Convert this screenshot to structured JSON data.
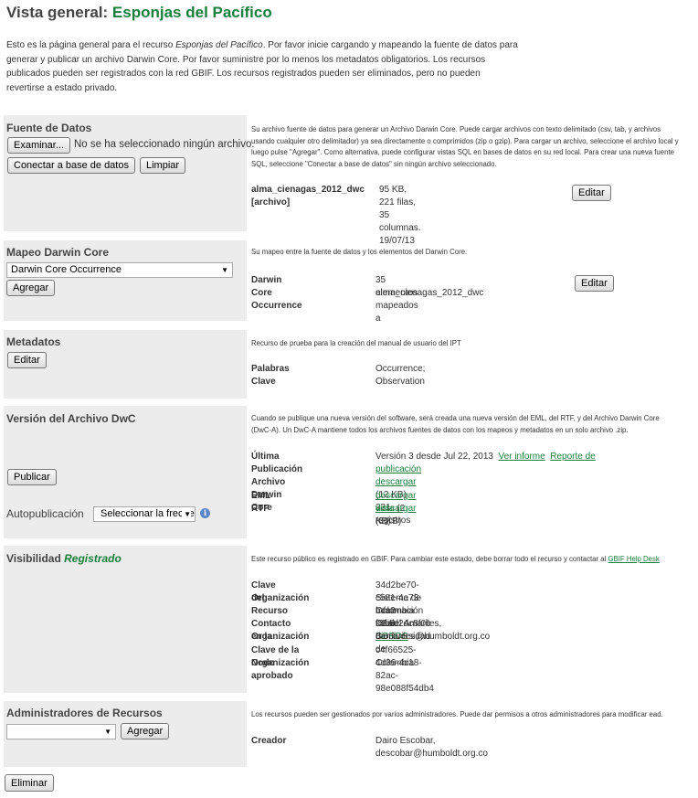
{
  "page": {
    "title_prefix": "Vista general:",
    "resource_name": "Esponjas del Pacífico",
    "intro_part1": "Esto es la página general para el recurso ",
    "intro_resource": "Esponjas del Pacífico",
    "intro_part2": ". Por favor inicie cargando y mapeando la fuente de datos para generar y publicar un archivo Darwin Core. Por favor suministre por lo menos los metadatos obligatorios. Los recursos publicados pueden ser registrados con la red GBIF. Los recursos registrados pueden ser eliminados, pero no pueden revertirse a estado privado."
  },
  "sources": {
    "title": "Fuente de Datos",
    "browse_label": "Examinar...",
    "no_file": "No se ha seleccionado ningún archivo.",
    "connect_label": "Conectar a base de datos",
    "clear_label": "Limpiar",
    "description": "Su archivo fuente de datos para generar un Archivo Darwin Core. Puede cargar archivos con texto delimitado (csv, tab, y archivos usando cualquier otro delimitador) ya sea directamente o comprimidos (zip o gzip). Para cargar un archivo, seleccione el archivo local y luego pulse \"Agregar\".  Como alternativa, puede configurar vistas SQL en bases de datos en su red local. Para crear una nueva fuente SQL, seleccione \"Conectar a base de datos\" sin ningún archivo seleccionado.",
    "file_name": "alma_cienagas_2012_dwc",
    "file_type": "[archivo]",
    "file_info": "95 KB, 221 filas, 35 columnas. 19/07/13",
    "edit_label": "Editar"
  },
  "mapping": {
    "title": "Mapeo Darwin Core",
    "select_value": "Darwin Core Occurrence",
    "add_label": "Agregar",
    "description": "Su mapeo entre la fuente de datos y los elementos del Darwin Core.",
    "core_name": "Darwin Core Occurrence",
    "core_info_line1": "35 elementos mapeados a",
    "core_info_line2": "alma_cienagas_2012_dwc",
    "edit_label": "Editar"
  },
  "metadata": {
    "title": "Metadatos",
    "edit_label": "Editar",
    "description": "Recurso de prueba para la creación del manual de usuario del IPT",
    "keywords_label": "Palabras Clave",
    "keywords_value": "Occurrence; Observation"
  },
  "version": {
    "title": "Versión del Archivo DwC",
    "publish_label": "Publicar",
    "auto_label": "Autopublicación",
    "auto_select": "Seleccionar la frecuencia",
    "info_icon": "i",
    "description": "Cuando se publique una nueva versión del software, será creada una nueva versión del EML, del RTF, y del Archivo Darwin Core (DwC-A). Un DwC-A mantiene todos los archivos fuentes de datos con los mapeos y metadatos en un solo archivo .zip.",
    "last_pub_label": "Última Publicación",
    "last_pub_value": "Versión 3 desde Jul 22, 2013",
    "view_report": "Ver informe",
    "pub_report_1": "Reporte de",
    "pub_report_2": "publicación",
    "dwca_label": "Archivo Darwin Core",
    "dwca_download": "descargar",
    "dwca_info": "(12 KB) 221 registros",
    "eml_label": "EML",
    "eml_download": "descargar",
    "eml_view": "vista",
    "eml_info": "(2 KB)",
    "rtf_label": "RTF",
    "rtf_download": "descargar",
    "rtf_info": "(3 KB)"
  },
  "visibility": {
    "title": "Visibilidad",
    "status": "Registrado",
    "description": "Este recurso público es registrado en GBIF. Para cambiar este estado, debe borrar todo el recurso y contactar al",
    "helpdesk": "GBIF Help Desk",
    "resource_key_label": "Clave del Recurso",
    "resource_key_value": "34d2be70-c581-4e73-bca2-f51ad2dc8f0b",
    "gbrds": "GBRDS",
    "org_label": "Organización",
    "org_value_1": "Sistema de Información sobre Biodiversidad de",
    "org_value_2": "Colombia - SiB",
    "contact_label_1": "Contacto en la",
    "contact_label_2": "Organización",
    "contact_value": "Daniel Amariles, damariles@humboldt.org.co",
    "org_key_label": "Clave de la Organización",
    "org_key_value": "c4f66525-4d36-4c18-82ac-98e088f54db4",
    "node_label": "Nodo aprobado",
    "node_value": "Colombia"
  },
  "managers": {
    "title": "Administradores de Recursos",
    "select_value": "",
    "add_label": "Agregar",
    "description": "Los recursos pueden ser gestionados por varios administradores. Puede dar permisos a otros administradores para modificar ead.",
    "creator_label": "Creador",
    "creator_value": "Dairo Escobar, descobar@humboldt.org.co"
  },
  "footer": {
    "delete_label": "Eliminar"
  },
  "colors": {
    "accent_green": "#1a7f3c",
    "panel_gray": "#ececec",
    "info_blue": "#5b87c7"
  }
}
